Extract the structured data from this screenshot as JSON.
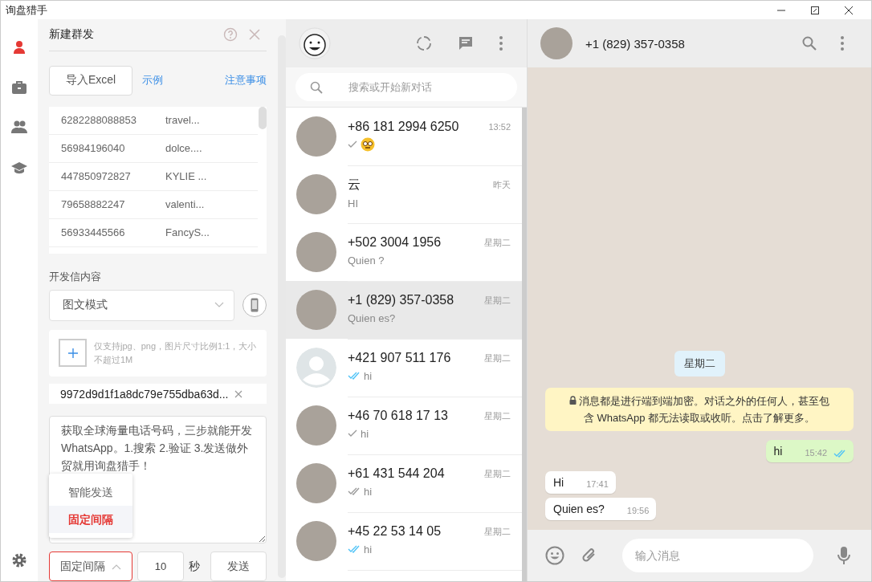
{
  "window": {
    "title": "询盘猎手"
  },
  "rail": [
    {
      "kind": "user",
      "selected": true
    },
    {
      "kind": "briefcase",
      "selected": false
    },
    {
      "kind": "group",
      "selected": false
    },
    {
      "kind": "cap",
      "selected": false
    }
  ],
  "panel": {
    "title": "新建群发",
    "import_button": "导入Excel",
    "example_link": "示例",
    "notes_link": "注意事项",
    "contacts": [
      {
        "phone": "6282288088853",
        "name": "travel..."
      },
      {
        "phone": "56984196040",
        "name": "dolce...."
      },
      {
        "phone": "447850972827",
        "name": "KYLIE ..."
      },
      {
        "phone": "79658882247",
        "name": "valenti..."
      },
      {
        "phone": "56933445566",
        "name": "FancyS..."
      }
    ],
    "content_label": "开发信内容",
    "mode_select": "图文模式",
    "upload_hint": "仅支持jpg、png，图片尺寸比例1:1，大小不超过1M",
    "file_name": "9972d9d1f1a8dc79e755dba63d...",
    "message": "获取全球海量电话号码，三步就能开发WhatsApp。1.搜索 2.验证 3.发送做外贸就用询盘猎手！",
    "send_options": [
      {
        "label": "智能发送",
        "selected": false
      },
      {
        "label": "固定间隔",
        "selected": true
      }
    ],
    "interval_select": {
      "value": "固定间隔",
      "expanded": true
    },
    "interval": "10",
    "unit": "秒",
    "send_button": "发送"
  },
  "chat_list": {
    "search_placeholder": "搜索或开始新对话",
    "chats": [
      {
        "name": "+86 181 2994 6250",
        "time": "13:52",
        "sent": true,
        "delivered": false,
        "read": false,
        "emoji": true,
        "kind": "photo",
        "selected": false
      },
      {
        "name": "云",
        "time": "昨天",
        "preview": "HI",
        "sent": false,
        "emoji": false,
        "kind": "photo",
        "selected": false
      },
      {
        "name": "+502 3004 1956",
        "time": "星期二",
        "preview": "Quien ?",
        "sent": false,
        "emoji": false,
        "kind": "photo",
        "selected": false
      },
      {
        "name": "+1 (829) 357-0358",
        "time": "星期二",
        "preview": "Quien es?",
        "sent": false,
        "emoji": false,
        "kind": "photo",
        "selected": true
      },
      {
        "name": "+421 907 511 176",
        "time": "星期二",
        "preview": "hi",
        "sent": true,
        "delivered": true,
        "read": true,
        "emoji": false,
        "kind": "default",
        "selected": false
      },
      {
        "name": "+46 70 618 17 13",
        "time": "星期二",
        "preview": "hi",
        "sent": true,
        "delivered": false,
        "read": false,
        "emoji": false,
        "kind": "photo",
        "selected": false
      },
      {
        "name": "+61 431 544 204",
        "time": "星期二",
        "preview": "hi",
        "sent": true,
        "delivered": true,
        "read": false,
        "emoji": false,
        "kind": "photo",
        "selected": false
      },
      {
        "name": "+45 22 53 14 05",
        "time": "星期二",
        "preview": "hi",
        "sent": true,
        "delivered": true,
        "read": true,
        "emoji": false,
        "kind": "photo",
        "selected": false
      }
    ]
  },
  "chat": {
    "contact": "+1 (829) 357-0358",
    "messages": [
      {
        "kind": "date",
        "text": "星期二"
      },
      {
        "kind": "notice",
        "text": "消息都是进行端到端加密。对话之外的任何人，甚至包含 WhatsApp 都无法读取或收听。点击了解更多。"
      },
      {
        "kind": "out",
        "text": "hi",
        "time": "15:42",
        "sent": true,
        "delivered": true,
        "read": true
      },
      {
        "kind": "in",
        "text": "Hi",
        "time": "17:41"
      },
      {
        "kind": "in",
        "text": "Quien es?",
        "time": "19:56"
      }
    ],
    "input_placeholder": "输入消息"
  }
}
